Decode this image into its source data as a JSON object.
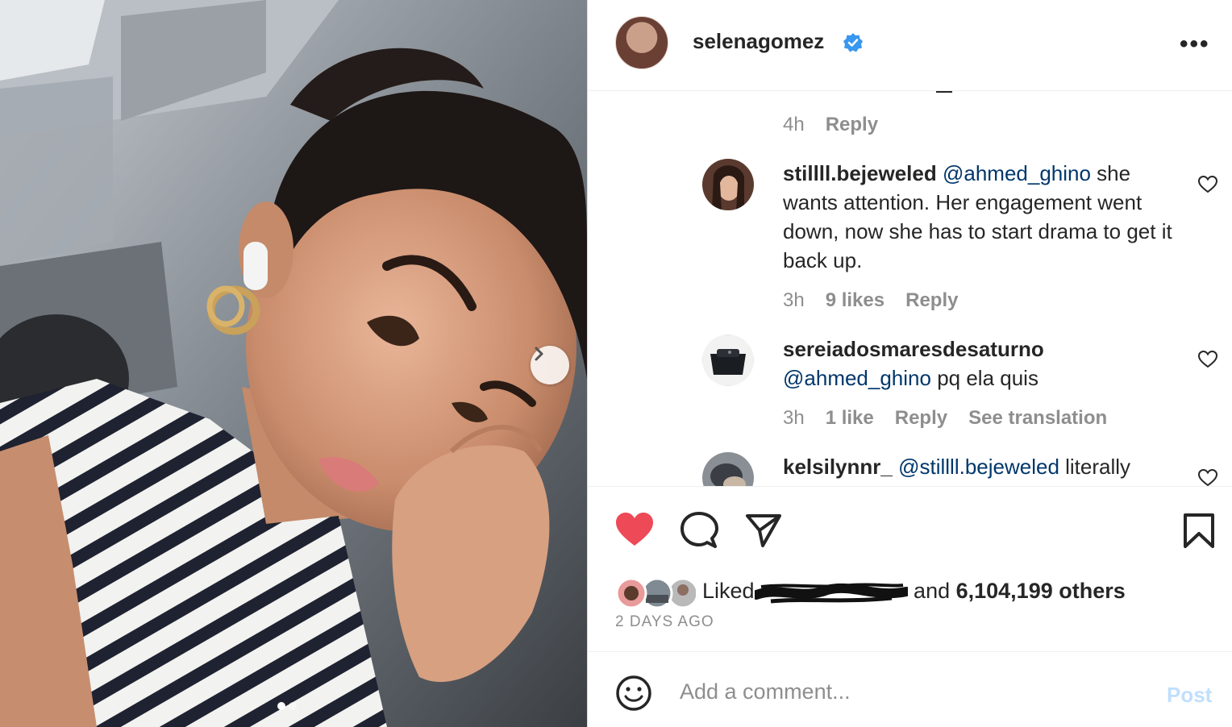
{
  "post": {
    "username": "selenagomez",
    "verified": true,
    "more_label": "•••",
    "slide_count": 2,
    "active_slide": 0
  },
  "comments": [
    {
      "partial": true,
      "time": "4h",
      "reply_label": "Reply"
    },
    {
      "username": "stillll.bejeweled",
      "mention": "@ahmed_ghino",
      "text": " she wants attention. Her engagement went down, now she has to start drama to get it back up.",
      "time": "3h",
      "likes": "9 likes",
      "reply_label": "Reply"
    },
    {
      "username": "sereiadosmaresdesaturno",
      "mention": "@ahmed_ghino",
      "text": " pq ela quis",
      "time": "3h",
      "likes": "1 like",
      "reply_label": "Reply",
      "translation_label": "See translation"
    },
    {
      "username": "kelsilynnr_",
      "mention": "@stillll.bejeweled",
      "text": " literally"
    }
  ],
  "likes": {
    "prefix": "Liked",
    "joiner": " and ",
    "count_text": "6,104,199 others",
    "liked": true
  },
  "date": "2 DAYS AGO",
  "comment_box": {
    "placeholder": "Add a comment...",
    "post_label": "Post"
  },
  "colors": {
    "heart": "#ed4956",
    "mention": "#00376b",
    "verified": "#3897f0",
    "muted": "#8e8e8e",
    "post_disabled": "#c0dffd"
  },
  "icons": [
    "chevron-right-icon",
    "verified-badge-icon",
    "heart-icon",
    "comment-icon",
    "share-icon",
    "bookmark-icon",
    "emoji-icon"
  ]
}
